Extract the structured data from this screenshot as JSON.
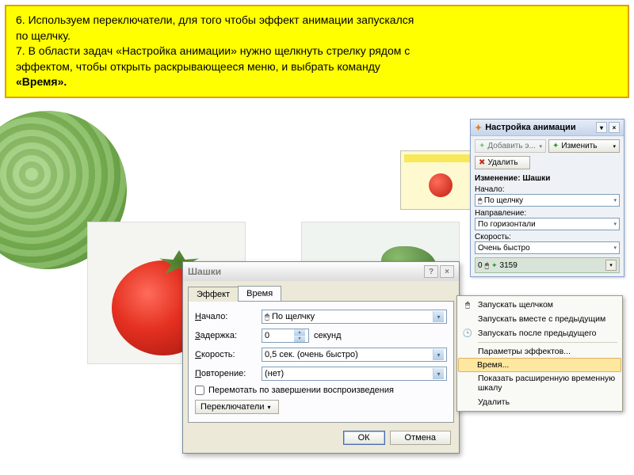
{
  "instructions": {
    "line1": "6. Используем  переключатели,  для того чтобы эффект анимации  запускался",
    "line1b": "    по щелчку.",
    "line2": "7. В области задач «Настройка анимации» нужно щелкнуть стрелку рядом с",
    "line2b": "    эффектом, чтобы открыть раскрывающееся меню, и выбрать команду",
    "line2c": "    «Время»."
  },
  "dialog": {
    "title": "Шашки",
    "tabs": {
      "effect": "Эффект",
      "time": "Время"
    },
    "labels": {
      "start": "Начало:",
      "delay": "Задержка:",
      "speed": "Скорость:",
      "repeat": "Повторение:",
      "seconds": "секунд",
      "rewind": "Перемотать по завершении воспроизведения",
      "triggers": "Переключатели"
    },
    "values": {
      "start": "По щелчку",
      "delay": "0",
      "speed": "0,5 сек. (очень быстро)",
      "repeat": "(нет)"
    },
    "buttons": {
      "ok": "ОК",
      "cancel": "Отмена"
    }
  },
  "taskpane": {
    "title": "Настройка анимации",
    "addEffect": "Добавить э...",
    "modify": "Изменить",
    "remove": "Удалить",
    "sectionLabel": "Изменение: Шашки",
    "fields": {
      "startLabel": "Начало:",
      "startValue": "По щелчку",
      "directionLabel": "Направление:",
      "directionValue": "По горизонтали",
      "speedLabel": "Скорость:",
      "speedValue": "Очень быстро"
    },
    "effectRow": {
      "index": "0",
      "name": "3159"
    }
  },
  "contextMenu": {
    "items": [
      "Запускать щелчком",
      "Запускать вместе с предыдущим",
      "Запускать после предыдущего",
      "Параметры эффектов...",
      "Время...",
      "Показать расширенную временную шкалу",
      "Удалить"
    ]
  }
}
